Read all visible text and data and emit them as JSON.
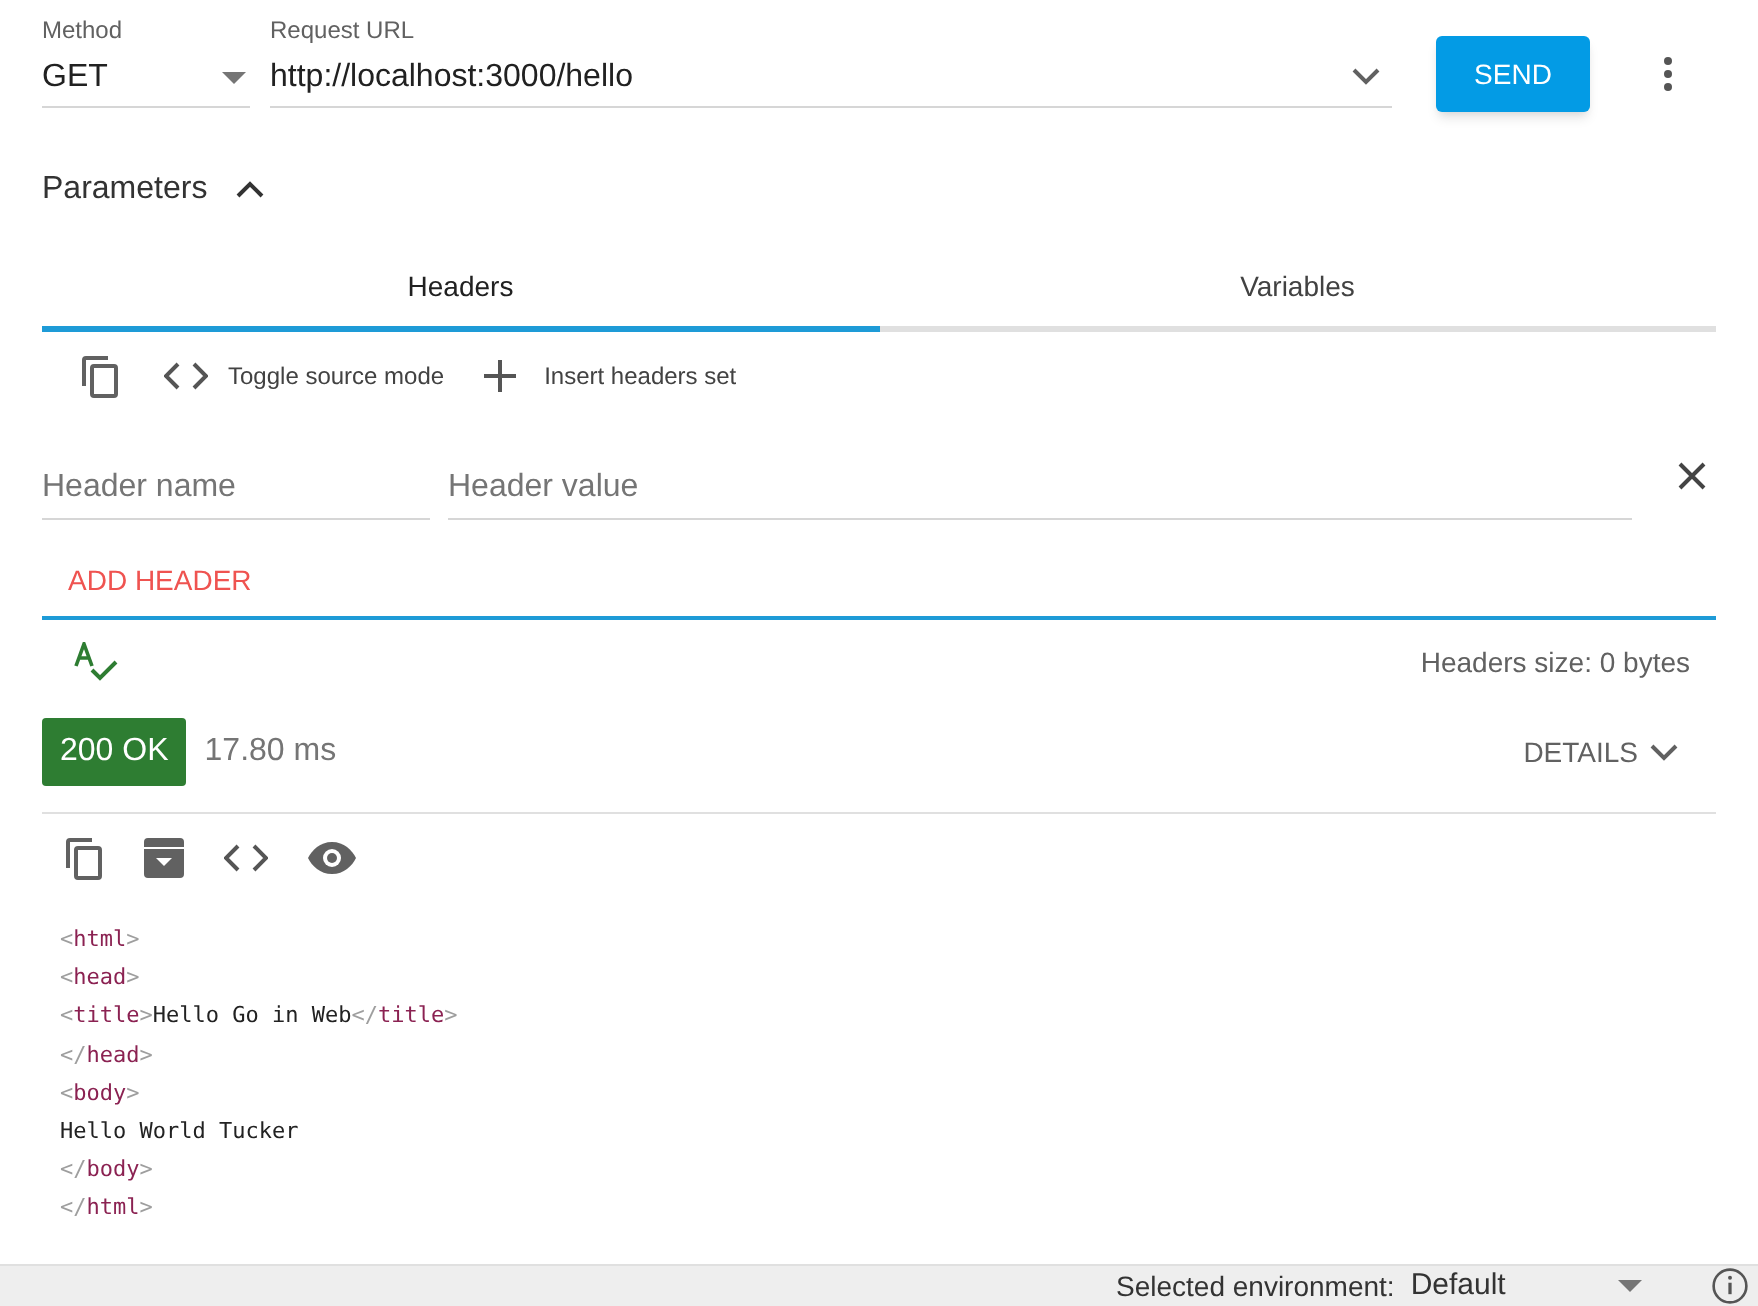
{
  "request": {
    "method_label": "Method",
    "method": "GET",
    "url_label": "Request URL",
    "url": "http://localhost:3000/hello",
    "send": "SEND"
  },
  "parameters": {
    "title": "Parameters",
    "expanded": true
  },
  "tabs": [
    {
      "label": "Headers",
      "selected": true
    },
    {
      "label": "Variables",
      "selected": false
    }
  ],
  "header_toolbar": {
    "toggle": "Toggle source mode",
    "insert": "Insert headers set"
  },
  "header_row": {
    "name_placeholder": "Header name",
    "value_placeholder": "Header value"
  },
  "add_header": "ADD HEADER",
  "headers_size": "Headers size: 0 bytes",
  "response": {
    "status": "200 OK",
    "time": "17.80 ms",
    "details": "DETAILS"
  },
  "code_lines": [
    "<html>",
    "<head>",
    "<title>Hello Go in Web</title>",
    "</head>",
    "<body>",
    "Hello World Tucker",
    "</body>",
    "</html>"
  ],
  "status_bar": {
    "environment_label": "Selected environment:",
    "environment": "Default"
  }
}
